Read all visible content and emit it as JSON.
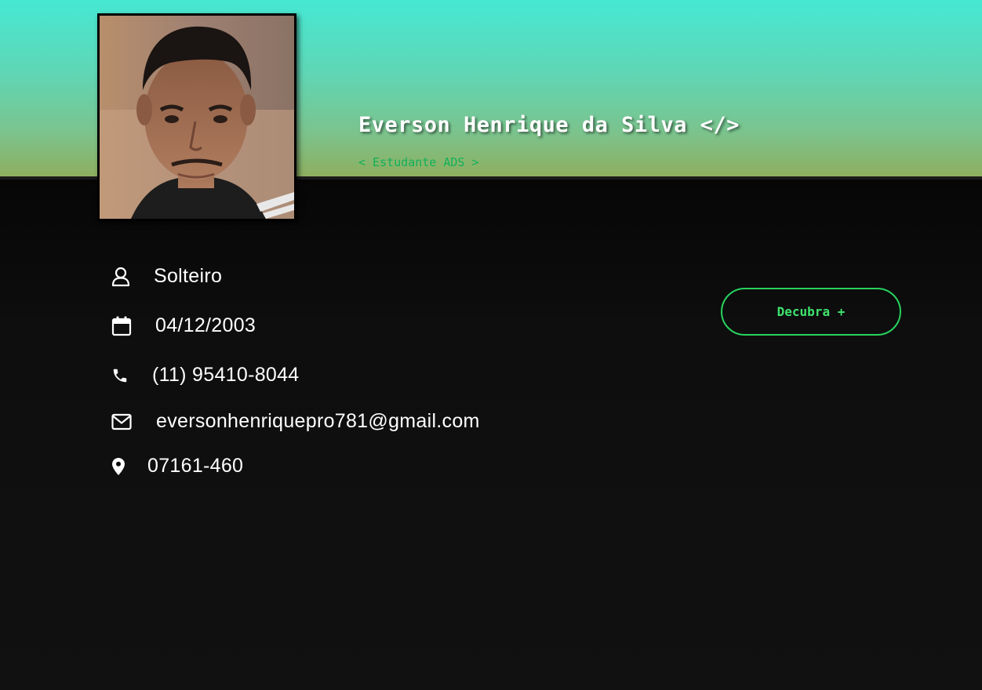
{
  "profile": {
    "name": "Everson Henrique da Silva",
    "name_icon": "</>",
    "role": "< Estudante ADS >"
  },
  "info": {
    "marital_status": {
      "icon": "user-icon",
      "value": "Solteiro"
    },
    "birth_date": {
      "icon": "calendar-icon",
      "value": "04/12/2003"
    },
    "phone": {
      "icon": "phone-icon",
      "value": "(11) 95410-8044"
    },
    "email": {
      "icon": "envelope-icon",
      "value": "eversonhenriquepro781@gmail.com"
    },
    "zip": {
      "icon": "map-pin-icon",
      "value": "07161-460"
    }
  },
  "cta": {
    "label": "Decubra +"
  },
  "colors": {
    "banner_top": "#46e8d3",
    "banner_bottom": "#8eaf5f",
    "accent_green": "#27d35e",
    "background": "#0f0f0f",
    "text": "#ffffff"
  }
}
